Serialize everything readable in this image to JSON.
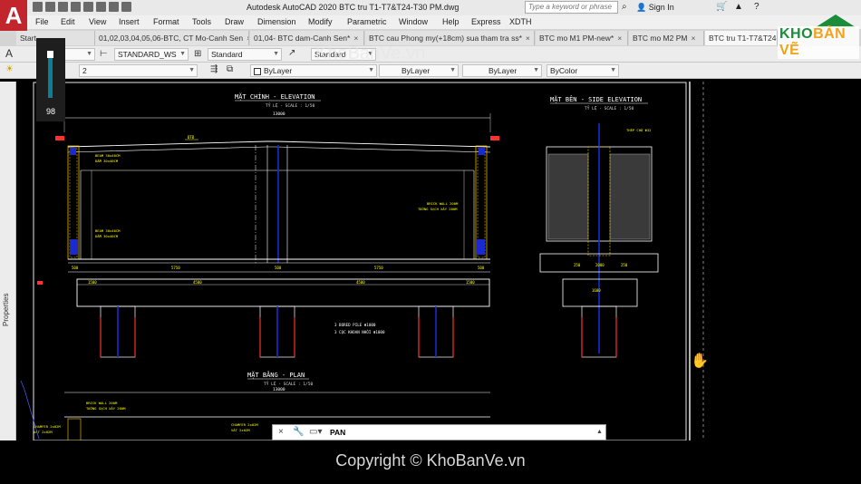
{
  "app": {
    "logo_letter": "A",
    "title": "Autodesk AutoCAD 2020   BTC tru T1-T7&T24-T30 PM.dwg",
    "search_placeholder": "Type a keyword or phrase",
    "sign_in": "Sign In"
  },
  "menu": [
    "File",
    "Edit",
    "View",
    "Insert",
    "Format",
    "Tools",
    "Draw",
    "Dimension",
    "Modify",
    "Parametric",
    "Window",
    "Help",
    "Express",
    "XDTH"
  ],
  "tabs": [
    {
      "label": "Start"
    },
    {
      "label": "01,02,03,04,05,06-BTC, CT Mo-Canh Sen"
    },
    {
      "label": "01,04- BTC dam-Canh Sen*"
    },
    {
      "label": "BTC cau Phong my(+18cm) sua tham tra ss*"
    },
    {
      "label": "BTC mo M1 PM-new*"
    },
    {
      "label": "BTC mo M2 PM"
    },
    {
      "label": "BTC tru T1-T7&T24-"
    }
  ],
  "toolbar1": {
    "text_style": "STANDARD_WS",
    "dim_style": "Standard",
    "table_style": "Standard"
  },
  "toolbar2": {
    "layer": "2",
    "color": "ByLayer",
    "linetype": "ByLayer",
    "lineweight": "ByLayer",
    "plotstyle": "ByColor"
  },
  "side_panel": "Properties",
  "fps_value": "98",
  "drawing": {
    "elevation_title": "MẶT CHÍNH - ELEVATION",
    "elevation_scale": "TỶ LỆ - SCALE : 1/50",
    "side_title": "MẶT BÊN - SIDE ELEVATION",
    "side_scale": "TỶ LỆ - SCALE : 1/50",
    "plan_title": "MẶT BẰNG - PLAN",
    "plan_scale": "TỶ LỆ - SCALE : 1/50",
    "dims_top": "13000",
    "dims_mid": [
      "500",
      "5750",
      "500",
      "5750",
      "500"
    ],
    "dims_lower": [
      "1500",
      "4500",
      "4500",
      "1500"
    ],
    "side_dims": [
      "250",
      "2000",
      "250"
    ],
    "side_dim2": "1600",
    "pile_note1": "3 BORED PILE Φ1000",
    "pile_note2": "3 CỌC KHOAN NHỒI Φ1000",
    "brick_note1": "BRICK WALL 200M",
    "brick_note2": "TƯỜNG GẠCH XÂY 200M",
    "beam_note1": "BEAM 30x40CM",
    "beam_note2": "DẦM 30x40CM",
    "chamfer1": "CHAMFER 2x02M",
    "chamfer2": "VÁT 2x02M",
    "steel_note": "THÉP CHỜ Φ32",
    "elev_label": "ĐTĐ"
  },
  "watermarks": {
    "center": "KhoBanVe.vn",
    "brand_left": "KHO",
    "brand_right": "BẢN VẼ",
    "copyright": "Copyright © KhoBanVe.vn"
  },
  "command": {
    "text": "PAN"
  }
}
